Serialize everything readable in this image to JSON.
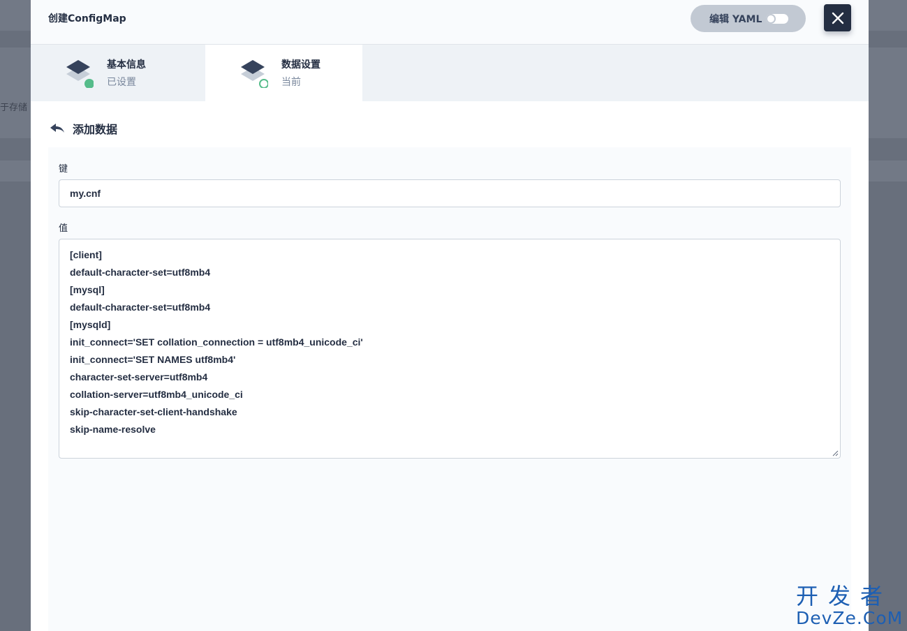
{
  "backdrop": {
    "peek_text": "于存储"
  },
  "modal": {
    "title": "创建ConfigMap",
    "yaml_toggle_label": "编辑 YAML",
    "steps": [
      {
        "title": "基本信息",
        "status": "已设置"
      },
      {
        "title": "数据设置",
        "status": "当前"
      }
    ],
    "section_title": "添加数据",
    "key_label": "键",
    "key_value": "my.cnf",
    "value_label": "值",
    "value_lines": [
      "[client]",
      "default-character-set=utf8mb4",
      "[mysql]",
      "default-character-set=utf8mb4",
      "[mysqld]",
      "init_connect='SET collation_connection = utf8mb4_unicode_ci'",
      "init_connect='SET NAMES utf8mb4'",
      "character-set-server=utf8mb4",
      "collation-server=utf8mb4_unicode_ci",
      "skip-character-set-client-handshake",
      "skip-name-resolve"
    ]
  },
  "watermark": {
    "top": "开发者",
    "bottom": "DevZe.CoM"
  },
  "colors": {
    "accent": "#242e42",
    "success": "#55bc8a",
    "toggle_bg": "#c2c9d3"
  },
  "icons": [
    "close-icon",
    "step-layers-icon",
    "back-arrow-icon",
    "resize-handle-icon"
  ]
}
